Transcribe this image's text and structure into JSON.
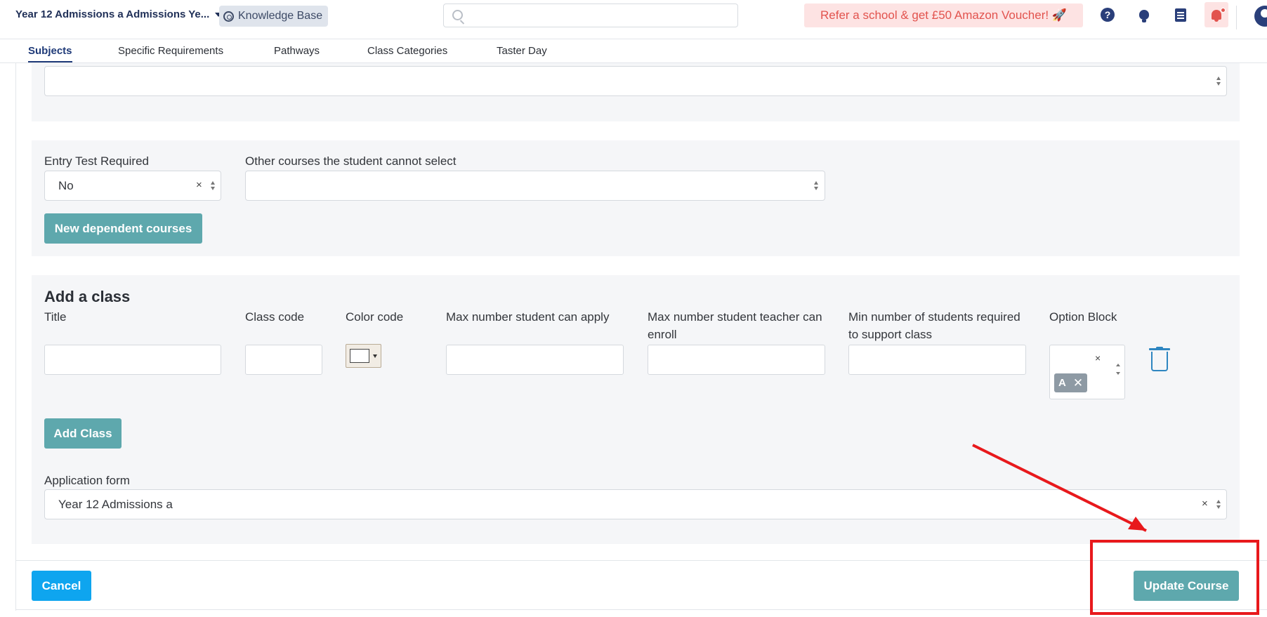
{
  "header": {
    "app_title": "Year 12 Admissions a Admissions Ye...",
    "knowledge_base": "Knowledge Base",
    "search_placeholder": "",
    "promo": "Refer a school & get £50 Amazon Voucher! 🚀",
    "help_glyph": "?"
  },
  "tabs": [
    {
      "label": "Subjects",
      "active": true
    },
    {
      "label": "Specific Requirements",
      "active": false
    },
    {
      "label": "Pathways",
      "active": false
    },
    {
      "label": "Class Categories",
      "active": false
    },
    {
      "label": "Taster Day",
      "active": false
    }
  ],
  "dependency": {
    "entry_test_label": "Entry Test Required",
    "entry_test_value": "No",
    "clear_glyph": "×",
    "other_courses_label": "Other courses the student cannot select",
    "other_courses_value": "",
    "new_dependent_button": "New dependent courses"
  },
  "add_class": {
    "title": "Add a class",
    "columns": {
      "title": "Title",
      "class_code": "Class code",
      "color_code": "Color code",
      "max_apply": "Max number student can apply",
      "max_teacher": "Max number student teacher can enroll",
      "min_students": "Min number of students required to support class",
      "option_block": "Option Block"
    },
    "option_block_tag": "A",
    "tag_remove_glyph": "✕",
    "add_button": "Add Class"
  },
  "application_form": {
    "label": "Application form",
    "value": "Year 12 Admissions a"
  },
  "footer": {
    "cancel": "Cancel",
    "update": "Update Course"
  },
  "colors": {
    "brand_navy": "#1f2f57",
    "teal_button": "#5ea8ad",
    "cancel_blue": "#0ea5ef",
    "promo_bg": "#fde3e3",
    "promo_text": "#e2534e",
    "annotation_red": "#e8191c",
    "trash_blue": "#2e86c1"
  },
  "icons": [
    "lifebuoy-icon",
    "search-icon",
    "help-icon",
    "lightbulb-icon",
    "document-icon",
    "bell-icon",
    "avatar-icon",
    "trash-icon",
    "chevron-down-icon"
  ]
}
